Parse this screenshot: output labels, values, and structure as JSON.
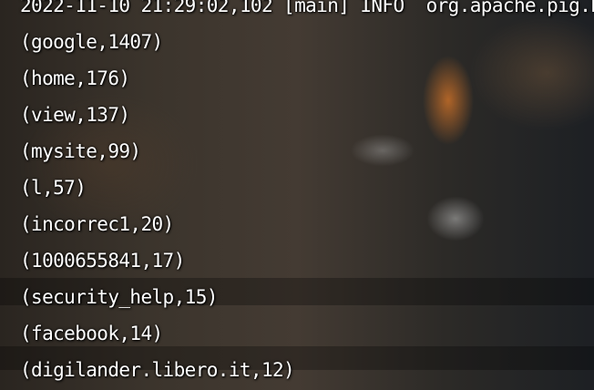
{
  "terminal": {
    "header_line": "2022-11-10 21:29:02,102 [main] INFO  org.apache.pig.b",
    "lines": [
      "(google,1407)",
      "(home,176)",
      "(view,137)",
      "(mysite,99)",
      "(l,57)",
      "(incorrec1,20)",
      "(1000655841,17)",
      "(security_help,15)",
      "(facebook,14)",
      "(digilander.libero.it,12)"
    ]
  }
}
